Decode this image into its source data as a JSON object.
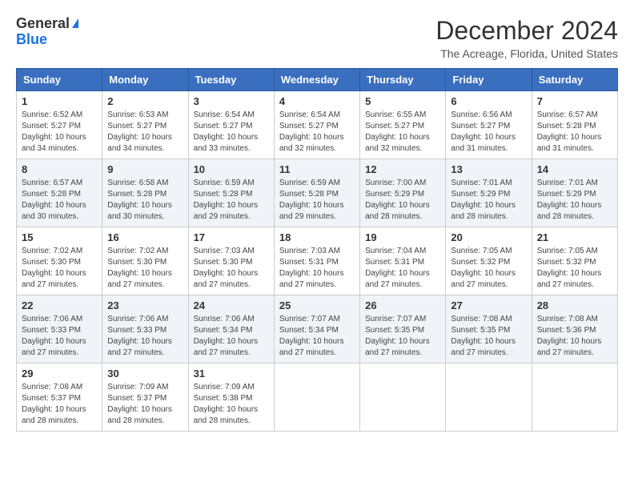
{
  "logo": {
    "line1": "General",
    "line2": "Blue"
  },
  "title": "December 2024",
  "subtitle": "The Acreage, Florida, United States",
  "weekdays": [
    "Sunday",
    "Monday",
    "Tuesday",
    "Wednesday",
    "Thursday",
    "Friday",
    "Saturday"
  ],
  "weeks": [
    [
      {
        "day": "1",
        "sunrise": "6:52 AM",
        "sunset": "5:27 PM",
        "daylight": "10 hours and 34 minutes."
      },
      {
        "day": "2",
        "sunrise": "6:53 AM",
        "sunset": "5:27 PM",
        "daylight": "10 hours and 34 minutes."
      },
      {
        "day": "3",
        "sunrise": "6:54 AM",
        "sunset": "5:27 PM",
        "daylight": "10 hours and 33 minutes."
      },
      {
        "day": "4",
        "sunrise": "6:54 AM",
        "sunset": "5:27 PM",
        "daylight": "10 hours and 32 minutes."
      },
      {
        "day": "5",
        "sunrise": "6:55 AM",
        "sunset": "5:27 PM",
        "daylight": "10 hours and 32 minutes."
      },
      {
        "day": "6",
        "sunrise": "6:56 AM",
        "sunset": "5:27 PM",
        "daylight": "10 hours and 31 minutes."
      },
      {
        "day": "7",
        "sunrise": "6:57 AM",
        "sunset": "5:28 PM",
        "daylight": "10 hours and 31 minutes."
      }
    ],
    [
      {
        "day": "8",
        "sunrise": "6:57 AM",
        "sunset": "5:28 PM",
        "daylight": "10 hours and 30 minutes."
      },
      {
        "day": "9",
        "sunrise": "6:58 AM",
        "sunset": "5:28 PM",
        "daylight": "10 hours and 30 minutes."
      },
      {
        "day": "10",
        "sunrise": "6:59 AM",
        "sunset": "5:28 PM",
        "daylight": "10 hours and 29 minutes."
      },
      {
        "day": "11",
        "sunrise": "6:59 AM",
        "sunset": "5:28 PM",
        "daylight": "10 hours and 29 minutes."
      },
      {
        "day": "12",
        "sunrise": "7:00 AM",
        "sunset": "5:29 PM",
        "daylight": "10 hours and 28 minutes."
      },
      {
        "day": "13",
        "sunrise": "7:01 AM",
        "sunset": "5:29 PM",
        "daylight": "10 hours and 28 minutes."
      },
      {
        "day": "14",
        "sunrise": "7:01 AM",
        "sunset": "5:29 PM",
        "daylight": "10 hours and 28 minutes."
      }
    ],
    [
      {
        "day": "15",
        "sunrise": "7:02 AM",
        "sunset": "5:30 PM",
        "daylight": "10 hours and 27 minutes."
      },
      {
        "day": "16",
        "sunrise": "7:02 AM",
        "sunset": "5:30 PM",
        "daylight": "10 hours and 27 minutes."
      },
      {
        "day": "17",
        "sunrise": "7:03 AM",
        "sunset": "5:30 PM",
        "daylight": "10 hours and 27 minutes."
      },
      {
        "day": "18",
        "sunrise": "7:03 AM",
        "sunset": "5:31 PM",
        "daylight": "10 hours and 27 minutes."
      },
      {
        "day": "19",
        "sunrise": "7:04 AM",
        "sunset": "5:31 PM",
        "daylight": "10 hours and 27 minutes."
      },
      {
        "day": "20",
        "sunrise": "7:05 AM",
        "sunset": "5:32 PM",
        "daylight": "10 hours and 27 minutes."
      },
      {
        "day": "21",
        "sunrise": "7:05 AM",
        "sunset": "5:32 PM",
        "daylight": "10 hours and 27 minutes."
      }
    ],
    [
      {
        "day": "22",
        "sunrise": "7:06 AM",
        "sunset": "5:33 PM",
        "daylight": "10 hours and 27 minutes."
      },
      {
        "day": "23",
        "sunrise": "7:06 AM",
        "sunset": "5:33 PM",
        "daylight": "10 hours and 27 minutes."
      },
      {
        "day": "24",
        "sunrise": "7:06 AM",
        "sunset": "5:34 PM",
        "daylight": "10 hours and 27 minutes."
      },
      {
        "day": "25",
        "sunrise": "7:07 AM",
        "sunset": "5:34 PM",
        "daylight": "10 hours and 27 minutes."
      },
      {
        "day": "26",
        "sunrise": "7:07 AM",
        "sunset": "5:35 PM",
        "daylight": "10 hours and 27 minutes."
      },
      {
        "day": "27",
        "sunrise": "7:08 AM",
        "sunset": "5:35 PM",
        "daylight": "10 hours and 27 minutes."
      },
      {
        "day": "28",
        "sunrise": "7:08 AM",
        "sunset": "5:36 PM",
        "daylight": "10 hours and 27 minutes."
      }
    ],
    [
      {
        "day": "29",
        "sunrise": "7:08 AM",
        "sunset": "5:37 PM",
        "daylight": "10 hours and 28 minutes."
      },
      {
        "day": "30",
        "sunrise": "7:09 AM",
        "sunset": "5:37 PM",
        "daylight": "10 hours and 28 minutes."
      },
      {
        "day": "31",
        "sunrise": "7:09 AM",
        "sunset": "5:38 PM",
        "daylight": "10 hours and 28 minutes."
      },
      null,
      null,
      null,
      null
    ]
  ]
}
